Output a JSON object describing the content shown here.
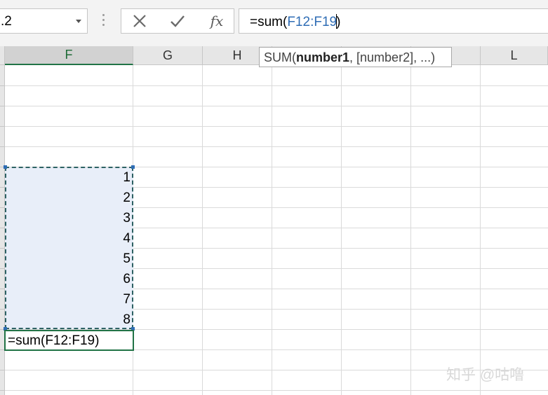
{
  "name_box": {
    "value": ".2"
  },
  "formula_bar": {
    "cancel_glyph": "✕",
    "enter_glyph": "✔",
    "fx_label": "fx",
    "prefix": "=sum(",
    "range_ref": "F12:F19",
    "suffix": ")"
  },
  "columns": [
    {
      "label": "F",
      "selected": true
    },
    {
      "label": "G"
    },
    {
      "label": "H"
    },
    {
      "label": ""
    },
    {
      "label": ""
    },
    {
      "label": ""
    },
    {
      "label": "L"
    }
  ],
  "cells": {
    "values": [
      "1",
      "2",
      "3",
      "4",
      "5",
      "6",
      "7",
      "8"
    ],
    "active_cell_text": "=sum(F12:F19)"
  },
  "tooltip": {
    "fn": "SUM(",
    "arg1": "number1",
    "rest": ", [number2], ...)"
  },
  "watermark": "知乎 @咕噜",
  "colors": {
    "range_fill": "#e8eef9",
    "range_border": "#2d6163",
    "accent_green": "#217346",
    "reference_blue": "#2f6db5"
  }
}
